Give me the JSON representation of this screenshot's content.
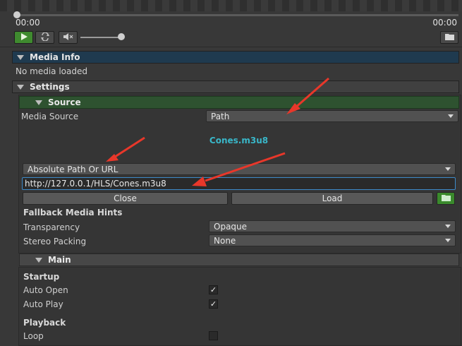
{
  "player": {
    "time_current": "00:00",
    "time_total": "00:00",
    "icons": {
      "play": "play-icon",
      "loop": "loop-icon",
      "mute": "mute-icon",
      "folder": "folder-icon"
    },
    "accent_play": "#3f8a2f"
  },
  "media_info": {
    "title": "Media Info",
    "status": "No media loaded"
  },
  "settings": {
    "title": "Settings",
    "source": {
      "title": "Source",
      "media_source_label": "Media Source",
      "media_source_value": "Path",
      "filename": "Cones.m3u8",
      "path_type": "Absolute Path Or URL",
      "url": "http://127.0.0.1/HLS/Cones.m3u8",
      "close_label": "Close",
      "load_label": "Load",
      "fallback_title": "Fallback Media Hints",
      "transparency_label": "Transparency",
      "transparency_value": "Opaque",
      "stereo_label": "Stereo Packing",
      "stereo_value": "None"
    },
    "main": {
      "title": "Main",
      "startup_title": "Startup",
      "auto_open_label": "Auto Open",
      "auto_open": true,
      "auto_play_label": "Auto Play",
      "auto_play": true,
      "playback_title": "Playback",
      "loop_label": "Loop",
      "loop": false
    }
  },
  "colors": {
    "media_info_header": "#1f3a4f",
    "source_header": "#2e5230",
    "filename_text": "#39b7c9",
    "annotation_arrow": "#e8372a"
  }
}
